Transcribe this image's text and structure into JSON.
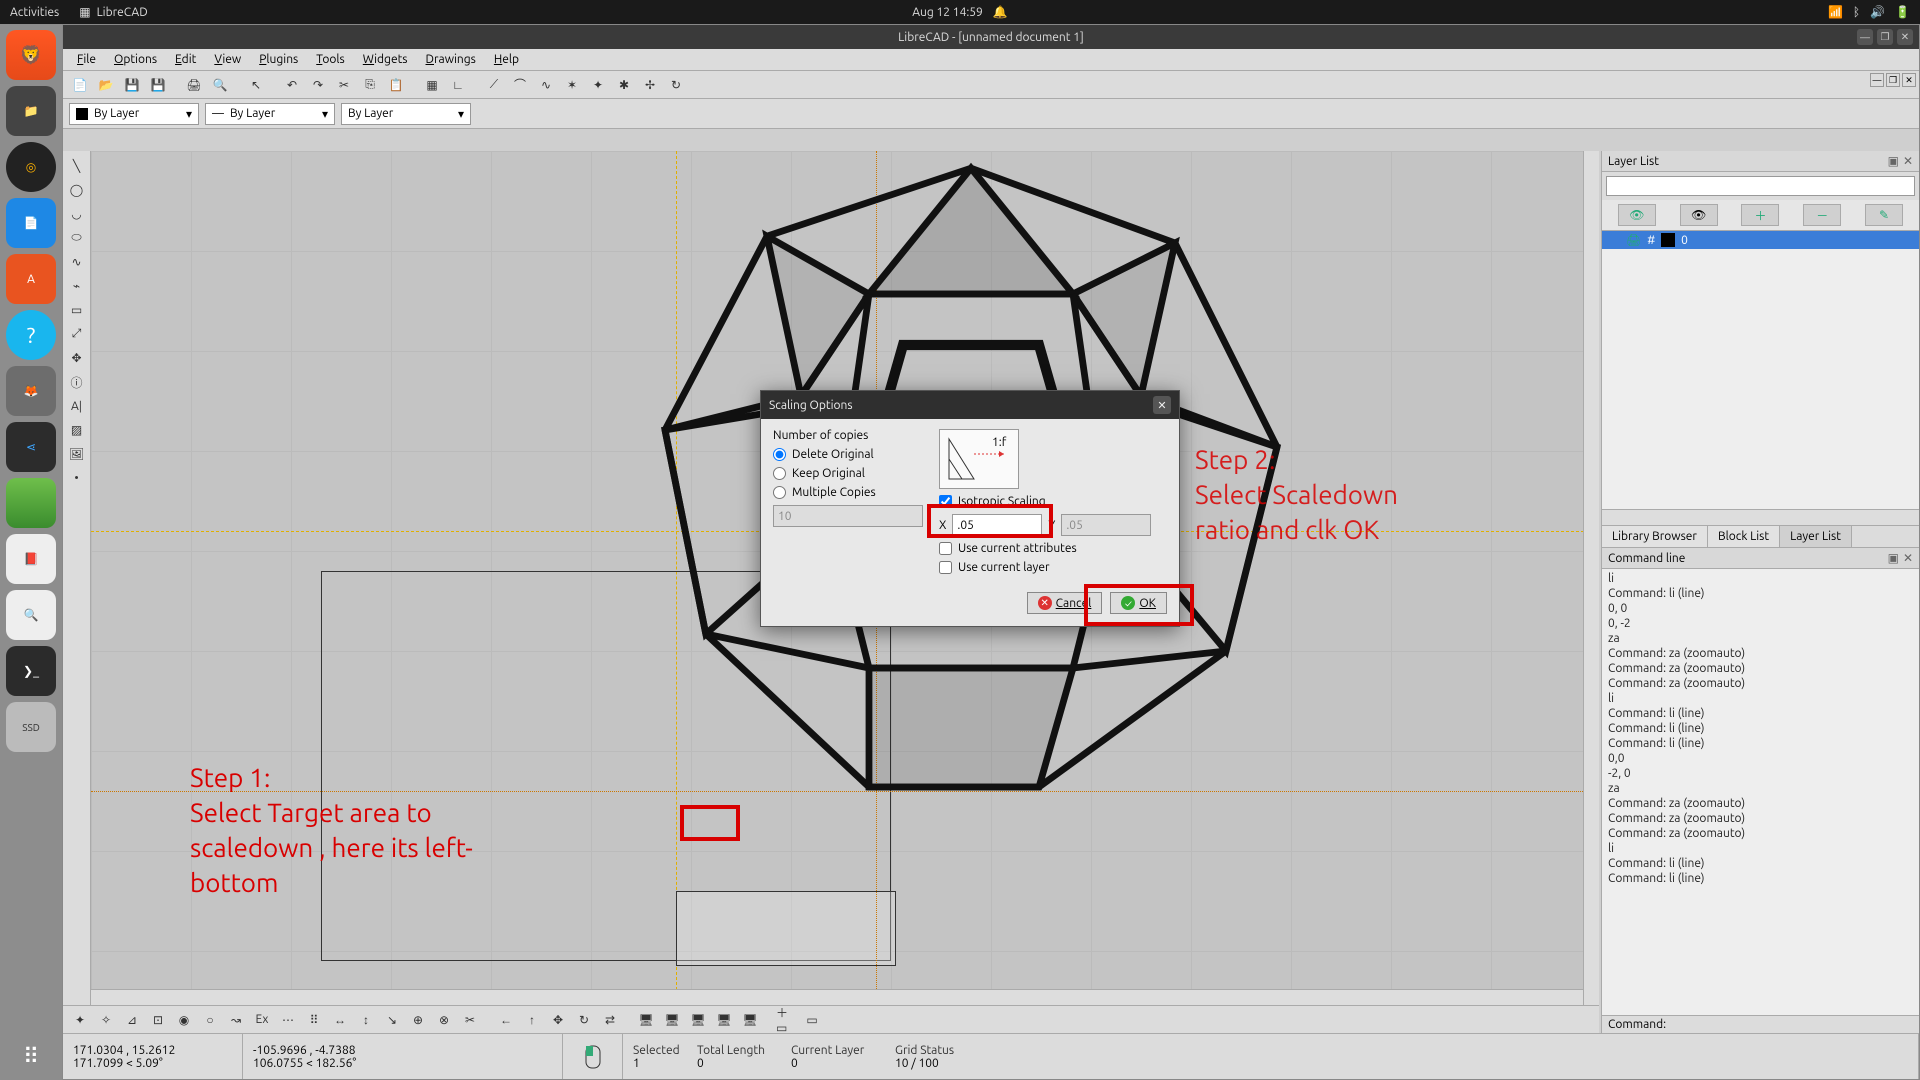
{
  "topbar": {
    "activities": "Activities",
    "app": "LibreCAD",
    "datetime": "Aug 12  14:59"
  },
  "window": {
    "title": "LibreCAD - [unnamed document 1]"
  },
  "menus": [
    "File",
    "Edit",
    "Options",
    "Edit",
    "View",
    "Plugins",
    "Tools",
    "Widgets",
    "Drawings",
    "Help"
  ],
  "menu": {
    "file": "File",
    "edit": "Edit",
    "options": "Options",
    "view": "View",
    "plugins": "Plugins",
    "tools": "Tools",
    "widgets": "Widgets",
    "drawings": "Drawings",
    "help": "Help"
  },
  "props": {
    "layer_combo": "By Layer",
    "linetype_combo": "By Layer",
    "width_combo": "By Layer"
  },
  "right": {
    "layerlist_title": "Layer List",
    "layer0": "0",
    "tabs": {
      "lib": "Library Browser",
      "block": "Block List",
      "layer": "Layer List"
    },
    "cmd_title": "Command line",
    "cmd_lines": [
      "li",
      "Command: li (line)",
      "0, 0",
      "0, -2",
      "za",
      "Command: za (zoomauto)",
      "Command: za (zoomauto)",
      "Command: za (zoomauto)",
      "li",
      "Command: li (line)",
      "Command: li (line)",
      "Command: li (line)",
      "0,0",
      "-2, 0",
      "za",
      "Command: za (zoomauto)",
      "Command: za (zoomauto)",
      "Command: za (zoomauto)",
      "li",
      "Command: li (line)",
      "Command: li (line)"
    ],
    "cmd_prompt": "Command:"
  },
  "dialog": {
    "title": "Scaling Options",
    "copies_label": "Number of copies",
    "delete": "Delete Original",
    "keep": "Keep Original",
    "multiple": "Multiple Copies",
    "copies_value": "10",
    "iso": "Isotropic Scaling",
    "x_label": "X",
    "x_value": ".05",
    "y_label": "Y",
    "y_value": ".05",
    "attr": "Use current attributes",
    "layer": "Use current layer",
    "cancel": "Cancel",
    "ok": "OK",
    "preview_ratio": "1:f"
  },
  "status": {
    "abs": "171.0304 , 15.2612",
    "polar": "171.7099 < 5.09°",
    "rel": "-105.9696 , -4.7388",
    "relpolar": "106.0755 < 182.56°",
    "h_selected": "Selected",
    "h_total": "Total Length",
    "h_layer": "Current Layer",
    "h_grid": "Grid Status",
    "v_selected": "1",
    "v_total": "0",
    "v_layer": "0",
    "v_grid": "10 / 100"
  },
  "annot": {
    "step1": "Step 1:\nSelect Target area to\nscaledown , here its left-\nbottom",
    "step2": "Step 2:\nSelect Scaledown\nratio and clk OK"
  }
}
